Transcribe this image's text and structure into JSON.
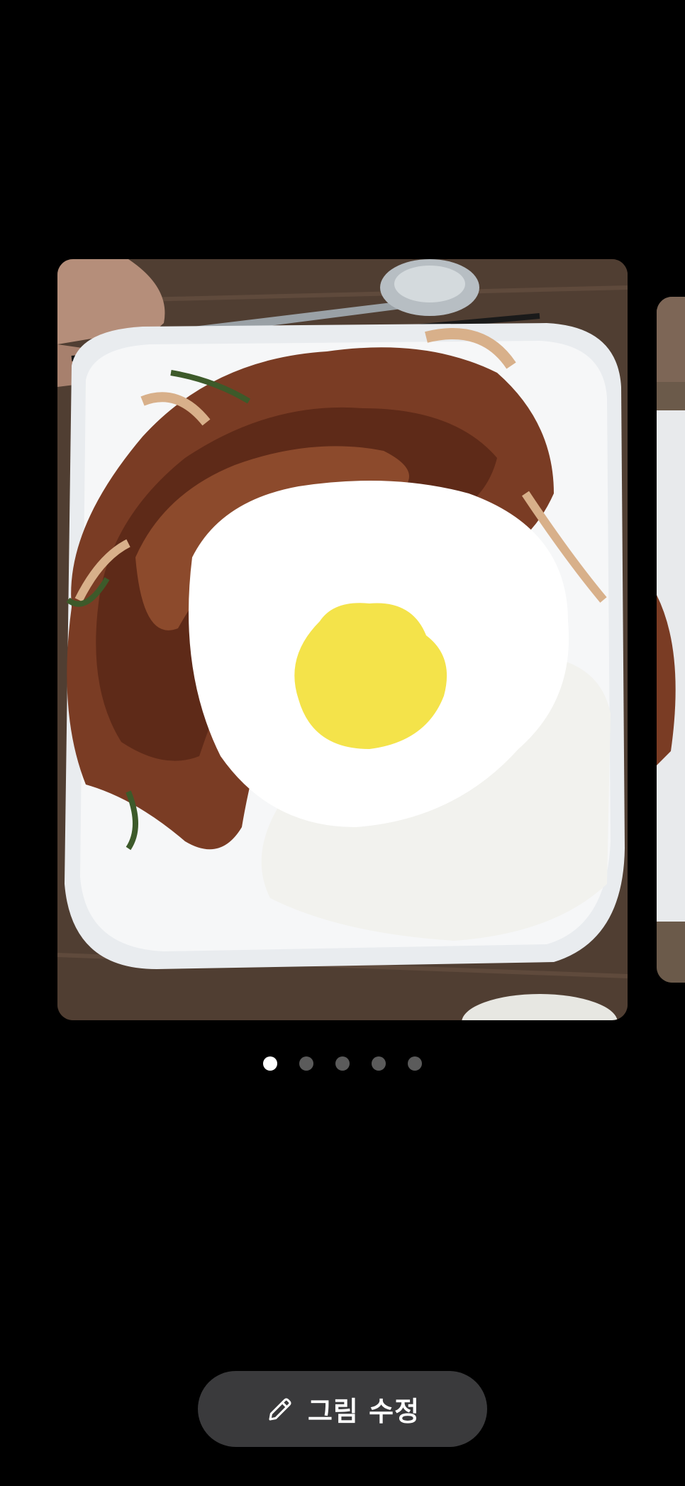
{
  "gallery": {
    "current_index": 1,
    "total_count": 5,
    "dots": [
      {
        "state": "active"
      },
      {
        "state": "inactive"
      },
      {
        "state": "inactive"
      },
      {
        "state": "inactive"
      },
      {
        "state": "inactive"
      }
    ]
  },
  "photo": {
    "subject": "food-photo-spicy-pork-rice-fried-egg"
  },
  "actions": {
    "edit_label": "그림 수정",
    "edit_icon": "pencil-icon"
  },
  "colors": {
    "background": "#000000",
    "button_bg": "#3a3a3c",
    "dot_active": "#ffffff",
    "dot_inactive": "#5b5b5b"
  }
}
